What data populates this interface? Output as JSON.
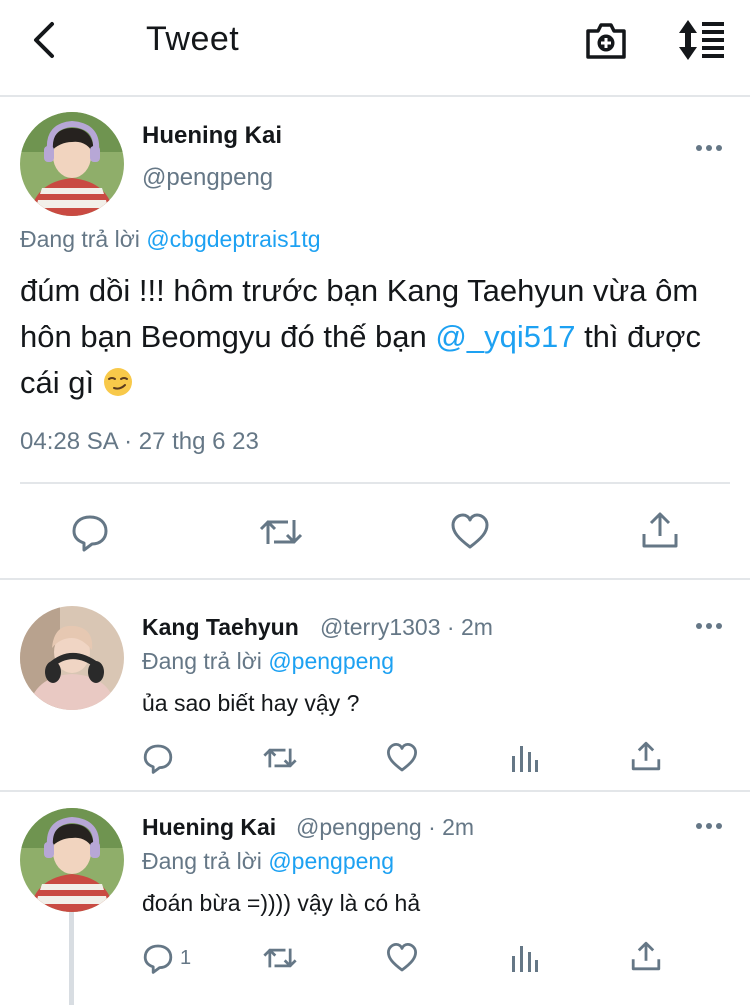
{
  "header": {
    "title": "Tweet"
  },
  "main_tweet": {
    "author_name": "Huening Kai",
    "author_handle": "@pengpeng",
    "replying_label": "Đang trả lời",
    "replying_to": "@cbgdeptrais1tg",
    "text_part1": "đúm dồi !!! hôm trước bạn Kang Taehyun vừa ôm hôn bạn Beomgyu đó thế bạn ",
    "text_mention": "@_yqi517",
    "text_part2": " thì được cái gì ",
    "emoji": "smirking-face",
    "timestamp": "04:28 SA · 27 thg 6 23"
  },
  "replies": [
    {
      "author_name": "Kang Taehyun",
      "author_handle": "@terry1303",
      "time": "· 2m",
      "replying_label": "Đang trả lời",
      "replying_to": "@pengpeng",
      "text": "ủa sao biết hay vậy ?",
      "reply_count": ""
    },
    {
      "author_name": "Huening Kai",
      "author_handle": "@pengpeng",
      "time": "· 2m",
      "replying_label": "Đang trả lời",
      "replying_to": "@pengpeng",
      "text": "đoán bừa =)))) vậy là có hả",
      "reply_count": "1"
    }
  ],
  "colors": {
    "accent": "#1da1f2",
    "secondary_text": "#657786",
    "divider": "#e3e6e9"
  },
  "icons": [
    "back-arrow-icon",
    "camera-plus-icon",
    "sort-icon",
    "more-icon",
    "reply-icon",
    "retweet-icon",
    "like-icon",
    "analytics-icon",
    "share-icon"
  ]
}
